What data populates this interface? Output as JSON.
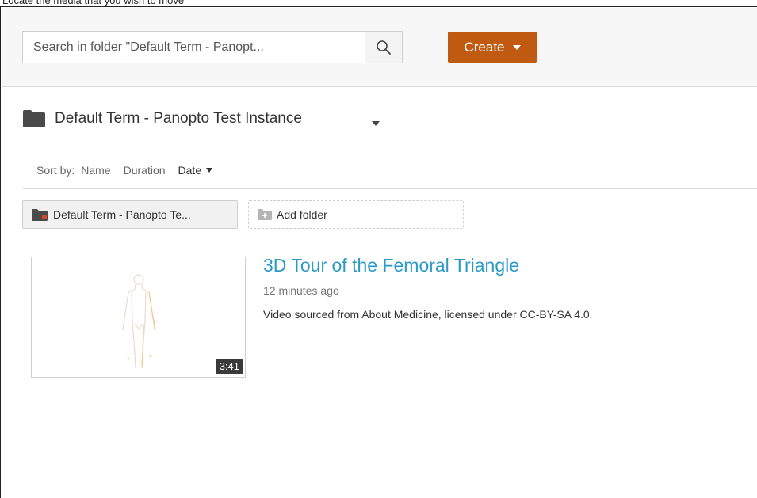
{
  "caption": "Locate the media that you wish to move",
  "search": {
    "placeholder": "Search in folder \"Default Term - Panopt...",
    "icon": "search-icon"
  },
  "create_button": {
    "label": "Create"
  },
  "folder": {
    "title": "Default Term - Panopto Test Instance",
    "icon": "folder-icon"
  },
  "sort": {
    "label": "Sort by:",
    "options": [
      "Name",
      "Duration",
      "Date"
    ],
    "active": "Date"
  },
  "breadcrumb_chip": {
    "label": "Default Term - Panopto Te..."
  },
  "add_folder": {
    "label": "Add folder"
  },
  "session": {
    "title": "3D Tour of the Femoral Triangle",
    "time": "12 minutes ago",
    "description": "Video sourced from About Medicine, licensed under CC-BY-SA 4.0.",
    "duration": "3:41"
  },
  "colors": {
    "accent": "#c05a10",
    "link": "#2b9ac7",
    "chip_folder_badge": "#d6452a"
  }
}
